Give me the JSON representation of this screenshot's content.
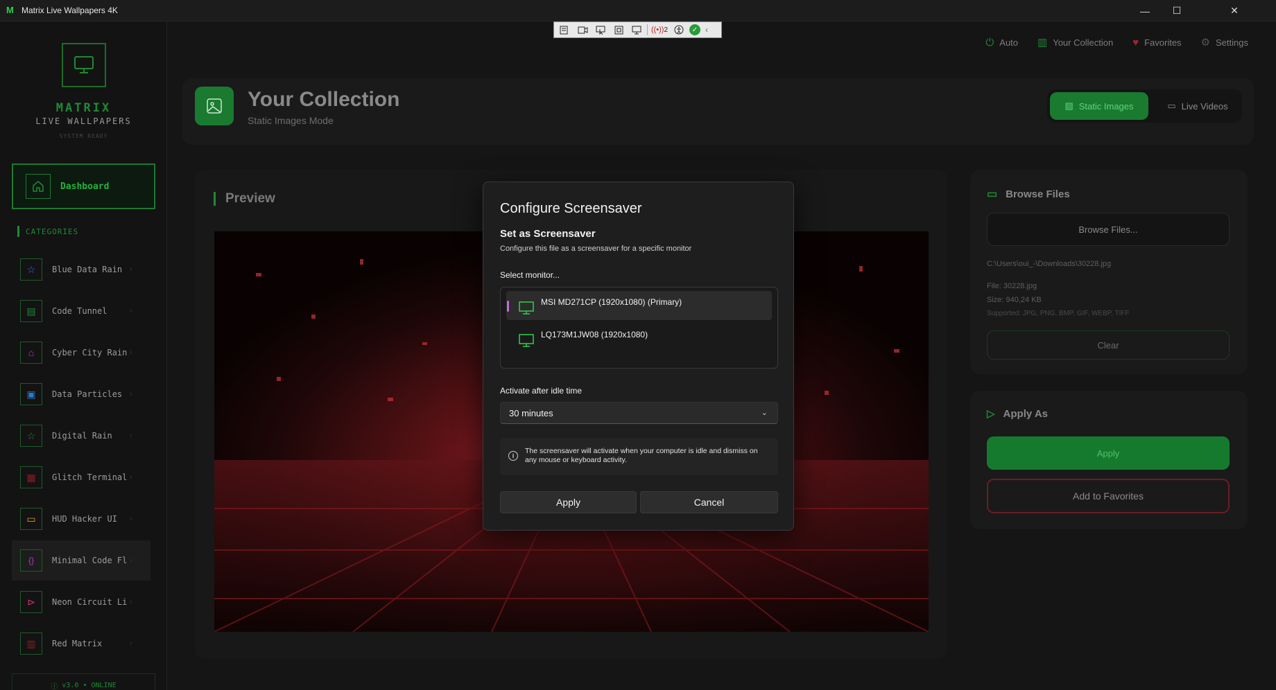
{
  "window": {
    "title": "Matrix Live Wallpapers 4K",
    "logo_letter": "M",
    "minimize": "—",
    "maximize": "☐",
    "close": "✕"
  },
  "toolbar": {
    "badge_count": "2"
  },
  "sidebar": {
    "brand_line1": "MATRIX",
    "brand_line2": "LIVE WALLPAPERS",
    "brand_line3": "SYSTEM READY",
    "dashboard_label": "Dashboard",
    "categories_label": "CATEGORIES",
    "categories": [
      {
        "label": "Blue Data Rain",
        "icon": "star-icon",
        "color": "#3a6fd8"
      },
      {
        "label": "Code Tunnel",
        "icon": "tunnel-icon",
        "color": "#1f8a34"
      },
      {
        "label": "Cyber City Rain",
        "icon": "city-icon",
        "color": "#b03ab8"
      },
      {
        "label": "Data Particles",
        "icon": "particles-icon",
        "color": "#2a7ac8"
      },
      {
        "label": "Digital Rain",
        "icon": "star-icon",
        "color": "#1f8a34"
      },
      {
        "label": "Glitch Terminal",
        "icon": "glitch-icon",
        "color": "#8a1e22"
      },
      {
        "label": "HUD Hacker UI",
        "icon": "monitor-icon",
        "color": "#c8a21e"
      },
      {
        "label": "Minimal Code Flow",
        "icon": "braces-icon",
        "color": "#b03ab8"
      },
      {
        "label": "Neon Circuit Lines",
        "icon": "circuit-icon",
        "color": "#c8306a"
      },
      {
        "label": "Red Matrix",
        "icon": "matrix-icon",
        "color": "#8a1e22"
      }
    ],
    "version": "v3.0 • ONLINE"
  },
  "topnav": {
    "items": [
      {
        "label": "Auto",
        "icon": "power-icon"
      },
      {
        "label": "Your Collection",
        "icon": "collection-icon"
      },
      {
        "label": "Favorites",
        "icon": "heart-icon"
      },
      {
        "label": "Settings",
        "icon": "gear-icon"
      }
    ]
  },
  "header": {
    "title": "Your Collection",
    "subtitle": "Static Images Mode",
    "mode_static": "Static Images",
    "mode_live": "Live Videos"
  },
  "preview": {
    "title": "Preview"
  },
  "browse": {
    "title": "Browse Files",
    "button": "Browse Files...",
    "path": "C:\\Users\\oui_-\\Downloads\\30228.jpg",
    "file": "File: 30228.jpg",
    "size": "Size: 940,24 KB",
    "supported": "Supported: JPG, PNG, BMP, GIF, WEBP, TIFF",
    "clear": "Clear"
  },
  "apply_as": {
    "title": "Apply As",
    "apply": "Apply",
    "favorites": "Add to Favorites"
  },
  "modal": {
    "title": "Configure Screensaver",
    "subtitle": "Set as Screensaver",
    "description": "Configure this file as a screensaver for a specific monitor",
    "monitor_label": "Select monitor...",
    "monitors": [
      {
        "label": "MSI MD271CP (1920x1080) (Primary)",
        "selected": true
      },
      {
        "label": "LQ173M1JW08 (1920x1080)",
        "selected": false
      }
    ],
    "idle_label": "Activate after idle time",
    "idle_value": "30 minutes",
    "info_text": "The screensaver will activate when your computer is idle and dismiss on any mouse or keyboard activity.",
    "apply": "Apply",
    "cancel": "Cancel"
  },
  "colors": {
    "accent_green": "#1f8a34",
    "bright_green": "#2fd24a",
    "danger_red": "#6a1e22",
    "selection_purple": "#c46cd4"
  }
}
